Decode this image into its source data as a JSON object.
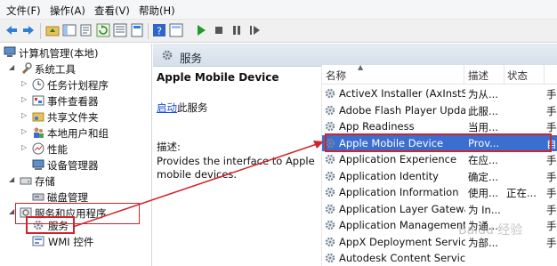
{
  "menu": [
    "文件(F)",
    "操作(A)",
    "查看(V)",
    "帮助(H)"
  ],
  "tree": {
    "root": "计算机管理(本地)",
    "system_tools": "系统工具",
    "task_scheduler": "任务计划程序",
    "event_viewer": "事件查看器",
    "shared_folders": "共享文件夹",
    "local_users": "本地用户和组",
    "performance": "性能",
    "device_manager": "设备管理器",
    "storage": "存储",
    "disk_management": "磁盘管理",
    "services_apps": "服务和应用程序",
    "services": "服务",
    "wmi": "WMI 控件"
  },
  "middle": {
    "header": "服务",
    "service_name": "Apple Mobile Device",
    "start_link": "启动",
    "start_suffix": "此服务",
    "desc_label": "描述:",
    "description": "Provides the interface to Apple mobile devices."
  },
  "list": {
    "columns": {
      "name": "名称",
      "desc": "描述",
      "state": "状态"
    },
    "rows": [
      {
        "name": "ActiveX Installer (AxInstSV)",
        "desc": "为从...",
        "state": "",
        "start": "手"
      },
      {
        "name": "Adobe Flash Player Upda...",
        "desc": "此服...",
        "state": "",
        "start": "手"
      },
      {
        "name": "App Readiness",
        "desc": "当用...",
        "state": "",
        "start": "手"
      },
      {
        "name": "Apple Mobile Device",
        "desc": "Prov...",
        "state": "",
        "start": "自"
      },
      {
        "name": "Application Experience",
        "desc": "在应...",
        "state": "",
        "start": "手"
      },
      {
        "name": "Application Identity",
        "desc": "确定...",
        "state": "",
        "start": "手"
      },
      {
        "name": "Application Information",
        "desc": "使用...",
        "state": "正在...",
        "start": "手"
      },
      {
        "name": "Application Layer Gatewa...",
        "desc": "为 In...",
        "state": "",
        "start": "手"
      },
      {
        "name": "Application Management",
        "desc": "为通...",
        "state": "",
        "start": "手"
      },
      {
        "name": "AppX Deployment Servic...",
        "desc": "为部...",
        "state": "",
        "start": "手"
      },
      {
        "name": "Autodesk Content Service",
        "desc": "",
        "state": "",
        "start": ""
      }
    ],
    "selected_index": 3
  },
  "watermark": "Baidu 经验",
  "colors": {
    "selection": "#3a6ecf",
    "highlight": "#d0232b",
    "link": "#1a4ed8"
  }
}
